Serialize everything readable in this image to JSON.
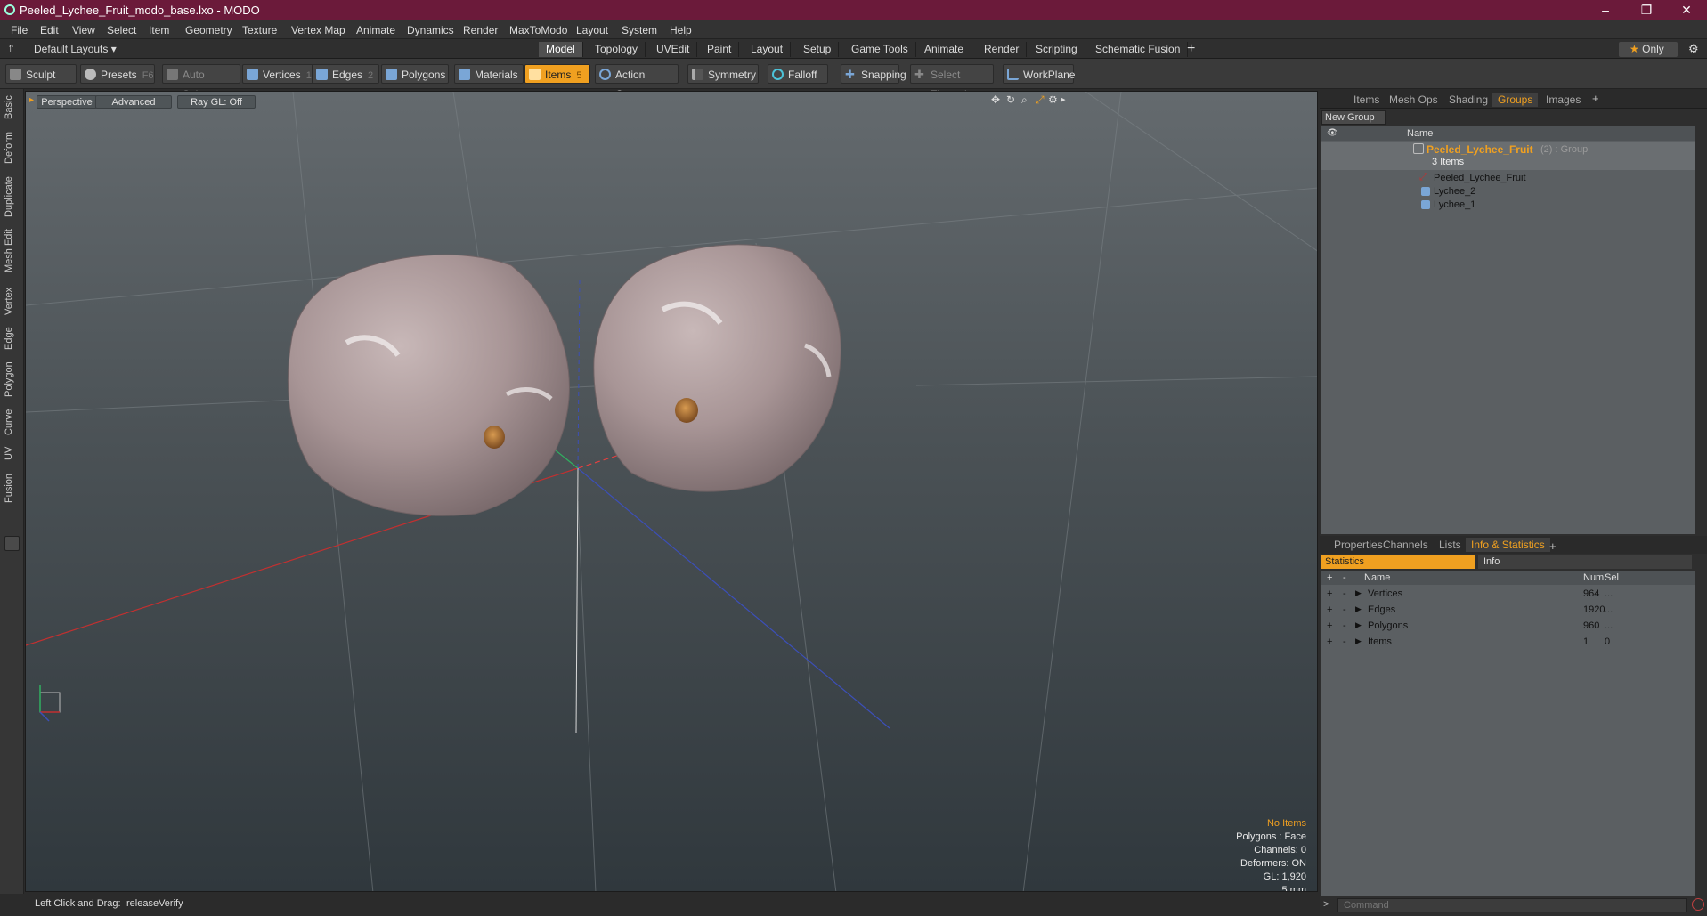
{
  "window": {
    "title": "Peeled_Lychee_Fruit_modo_base.lxo - MODO",
    "minimize": "–",
    "maximize": "❐",
    "close": "✕"
  },
  "menu": [
    "File",
    "Edit",
    "View",
    "Select",
    "Item",
    "Geometry",
    "Texture",
    "Vertex Map",
    "Animate",
    "Dynamics",
    "Render",
    "MaxToModo",
    "Layout",
    "System",
    "Help"
  ],
  "layout": {
    "preset": "Default Layouts ▾",
    "tabs": [
      "Model",
      "Topology",
      "UVEdit",
      "Paint",
      "Layout",
      "Setup",
      "Game Tools",
      "Animate",
      "Render",
      "Scripting",
      "Schematic Fusion"
    ],
    "active_tab": "Model",
    "add": "+",
    "only": "Only",
    "only_icon": "star-icon"
  },
  "toolbar": {
    "sculpt": "Sculpt",
    "presets": "Presets",
    "presets_key": "F6",
    "auto_select": "Auto Select",
    "vertices": "Vertices",
    "vertices_count": "1",
    "edges": "Edges",
    "edges_count": "2",
    "polygons": "Polygons",
    "materials": "Materials",
    "items": "Items",
    "items_count": "5",
    "action_center": "Action Center",
    "symmetry": "Symmetry",
    "falloff": "Falloff",
    "snapping": "Snapping",
    "select_through": "Select Through",
    "workplane": "WorkPlane"
  },
  "left_tabs": [
    "Basic",
    "Deform",
    "Duplicate",
    "Mesh Edit",
    "Vertex",
    "Edge",
    "Polygon",
    "Curve",
    "UV",
    "Fusion"
  ],
  "viewport": {
    "view": "Perspective",
    "shading": "Advanced",
    "raygl": "Ray GL: Off",
    "info": {
      "selection": "No Items",
      "polygons": "Polygons : Face",
      "channels": "Channels: 0",
      "deformers": "Deformers: ON",
      "gl": "GL: 1,920",
      "scale": "5 mm"
    },
    "colors": {
      "accent": "#f0a020",
      "fruit": "#a89596",
      "seed": "#b07a3a"
    }
  },
  "status": {
    "hint": "Left Click and Drag:",
    "action": "releaseVerify"
  },
  "groups_panel": {
    "tabs": [
      "Items",
      "Mesh Ops",
      "Shading",
      "Groups",
      "Images"
    ],
    "active_tab": "Groups",
    "new_group": "New Group",
    "column": "Name",
    "group_name": "Peeled_Lychee_Fruit",
    "group_suffix": "(2) : Group",
    "group_count": "3 Items",
    "children": [
      "Peeled_Lychee_Fruit",
      "Lychee_2",
      "Lychee_1"
    ]
  },
  "stats_panel": {
    "tabs": [
      "Properties",
      "Channels",
      "Lists",
      "Info & Statistics"
    ],
    "active_tab": "Info & Statistics",
    "subtabs": [
      "Statistics",
      "Info"
    ],
    "headers": {
      "name": "Name",
      "num": "Num",
      "sel": "Sel"
    },
    "rows": [
      {
        "name": "Vertices",
        "num": "964",
        "sel": "..."
      },
      {
        "name": "Edges",
        "num": "1920",
        "sel": "..."
      },
      {
        "name": "Polygons",
        "num": "960",
        "sel": "..."
      },
      {
        "name": "Items",
        "num": "1",
        "sel": "0"
      }
    ]
  },
  "command": {
    "placeholder": "Command"
  }
}
